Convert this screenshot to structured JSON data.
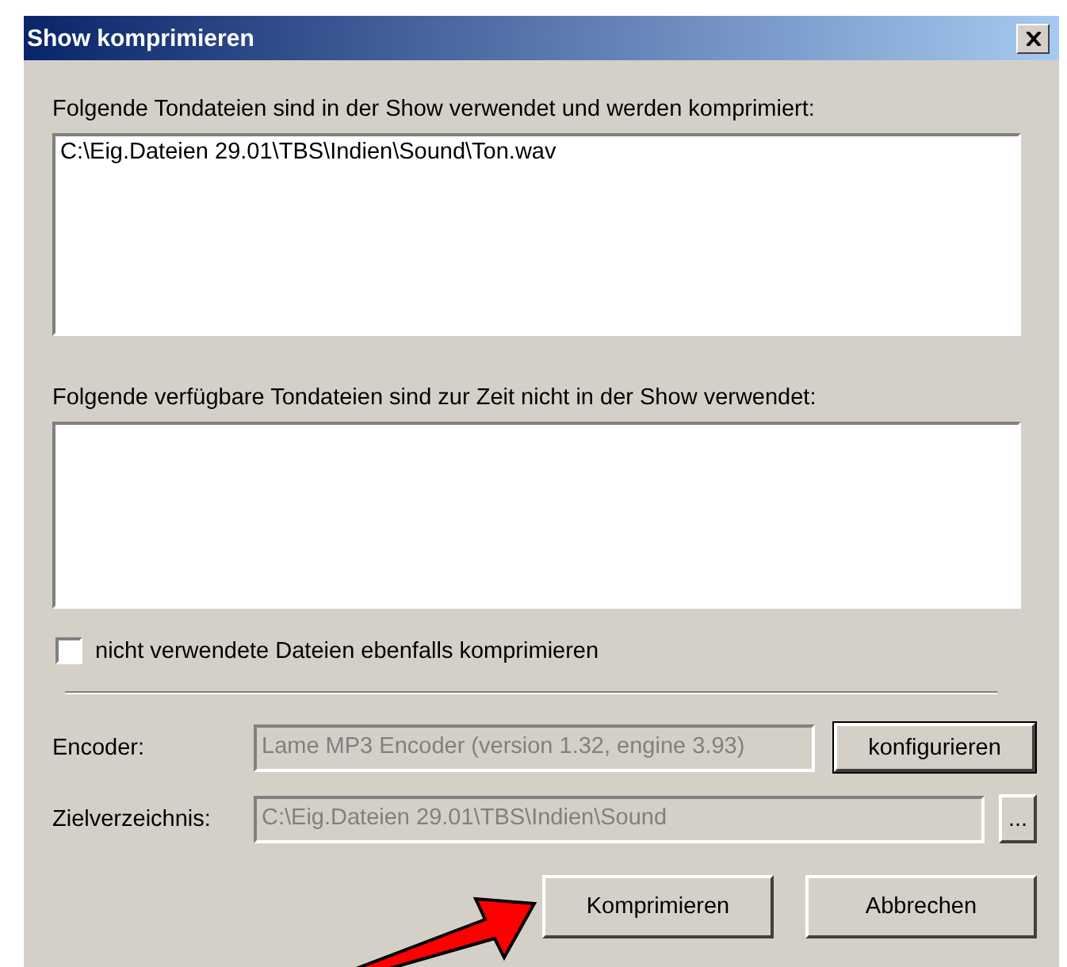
{
  "window": {
    "title": "Show komprimieren"
  },
  "used_files": {
    "label": "Folgende Tondateien sind in der Show verwendet und werden komprimiert:",
    "items": [
      "C:\\Eig.Dateien 29.01\\TBS\\Indien\\Sound\\Ton.wav"
    ]
  },
  "unused_files": {
    "label": "Folgende verfügbare Tondateien sind zur Zeit nicht in der Show verwendet:"
  },
  "compress_unused": {
    "label": "nicht verwendete Dateien ebenfalls komprimieren",
    "checked": false
  },
  "encoder": {
    "label": "Encoder:",
    "value": "Lame MP3 Encoder (version 1.32, engine 3.93)",
    "disabled": true,
    "button": "konfigurieren"
  },
  "target": {
    "label": "Zielverzeichnis:",
    "value": "C:\\Eig.Dateien 29.01\\TBS\\Indien\\Sound",
    "disabled": true,
    "button": "..."
  },
  "buttons": [
    {
      "label": "Komprimieren",
      "default": false
    },
    {
      "label": "Abbrechen",
      "default": false
    }
  ]
}
